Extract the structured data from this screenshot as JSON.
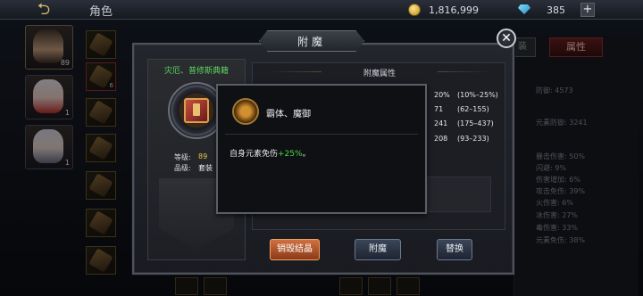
{
  "topbar": {
    "title": "角色",
    "gold": "1,816,999",
    "gems": "385",
    "plus": "+"
  },
  "heroes": [
    {
      "level": "89"
    },
    {
      "level": "1"
    },
    {
      "level": "1"
    }
  ],
  "slots": [
    {
      "count": ""
    },
    {
      "count": "6"
    },
    {
      "count": ""
    },
    {
      "count": ""
    },
    {
      "count": ""
    },
    {
      "count": ""
    },
    {
      "count": ""
    }
  ],
  "right_tabs": {
    "left_label": "装",
    "attr_label": "属性"
  },
  "right_stats": [
    "防御: 4573",
    "元素防御: 3241",
    "暴击伤害: 50%",
    "闪避: 9%",
    "伤害增加: 6%",
    "攻击免伤: 39%",
    "火伤害: 6%",
    "冰伤害: 27%",
    "毒伤害: 33%",
    "元素免伤: 38%"
  ],
  "dialog": {
    "title": "附魔",
    "close": "✕"
  },
  "book": {
    "name": "灾厄、普修斯典籍",
    "level_label": "等级:",
    "level": "89",
    "grade_label": "品级:",
    "grade": "套装"
  },
  "attributes": {
    "header": "附魔属性",
    "rows": [
      {
        "pct": "20%",
        "range": "(10%–25%)"
      },
      {
        "pct": "71",
        "range": "(62–155)"
      },
      {
        "pct": "241",
        "range": "(175–437)"
      },
      {
        "pct": "208",
        "range": "(93–233)"
      }
    ]
  },
  "tooltip": {
    "name": "霸体、魔御",
    "desc_prefix": "自身元素免伤",
    "desc_value": "+25%",
    "desc_suffix": "。"
  },
  "buttons": {
    "destroy": "销毁结晶",
    "enchant": "附魔",
    "replace": "替换"
  }
}
